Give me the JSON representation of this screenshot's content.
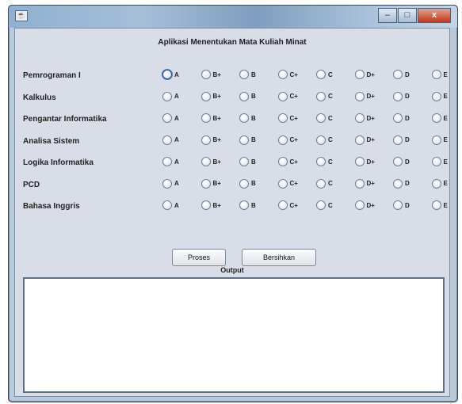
{
  "window": {
    "title": "",
    "controls": {
      "close": "x"
    }
  },
  "app": {
    "title": "Aplikasi Menentukan Mata Kuliah Minat"
  },
  "grades": [
    "A",
    "B+",
    "B",
    "C+",
    "C",
    "D+",
    "D",
    "E"
  ],
  "subjects": [
    {
      "label": "Pemrograman I"
    },
    {
      "label": "Kalkulus"
    },
    {
      "label": "Pengantar Informatika"
    },
    {
      "label": "Analisa Sistem"
    },
    {
      "label": "Logika Informatika"
    },
    {
      "label": "PCD"
    },
    {
      "label": "Bahasa Inggris"
    }
  ],
  "buttons": {
    "proses": "Proses",
    "bersihkan": "Bersihkan"
  },
  "output": {
    "label": "Output",
    "value": ""
  }
}
